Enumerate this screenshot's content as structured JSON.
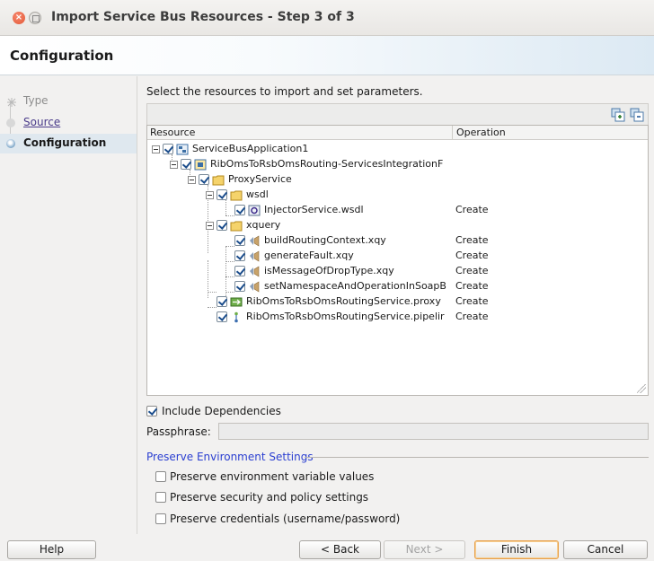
{
  "window": {
    "title": "Import Service Bus Resources - Step 3 of 3"
  },
  "header": {
    "title": "Configuration"
  },
  "steps": [
    {
      "label": "Type"
    },
    {
      "label": "Source"
    },
    {
      "label": "Configuration"
    }
  ],
  "main": {
    "instructions": "Select the resources to import and set parameters.",
    "columns": {
      "resource": "Resource",
      "operation": "Operation"
    },
    "tree": [
      {
        "name": "ServiceBusApplication1",
        "operation": ""
      },
      {
        "name": "RibOmsToRsbOmsRouting-ServicesIntegrationF",
        "operation": ""
      },
      {
        "name": "ProxyService",
        "operation": ""
      },
      {
        "name": "wsdl",
        "operation": ""
      },
      {
        "name": "InjectorService.wsdl",
        "operation": "Create"
      },
      {
        "name": "xquery",
        "operation": ""
      },
      {
        "name": "buildRoutingContext.xqy",
        "operation": "Create"
      },
      {
        "name": "generateFault.xqy",
        "operation": "Create"
      },
      {
        "name": "isMessageOfDropType.xqy",
        "operation": "Create"
      },
      {
        "name": "setNamespaceAndOperationInSoapB",
        "operation": "Create"
      },
      {
        "name": "RibOmsToRsbOmsRoutingService.proxy",
        "operation": "Create"
      },
      {
        "name": "RibOmsToRsbOmsRoutingService.pipelir",
        "operation": "Create"
      }
    ],
    "include_dependencies": {
      "label": "Include Dependencies",
      "checked": true
    },
    "passphrase": {
      "label": "Passphrase:",
      "value": ""
    },
    "preserve": {
      "title": "Preserve Environment Settings",
      "options": [
        {
          "label": "Preserve environment variable values",
          "checked": false
        },
        {
          "label": "Preserve security and policy settings",
          "checked": false
        },
        {
          "label": "Preserve credentials (username/password)",
          "checked": false
        }
      ]
    }
  },
  "buttons": {
    "help": "Help",
    "back": "< Back",
    "next": "Next >",
    "finish": "Finish",
    "cancel": "Cancel"
  }
}
